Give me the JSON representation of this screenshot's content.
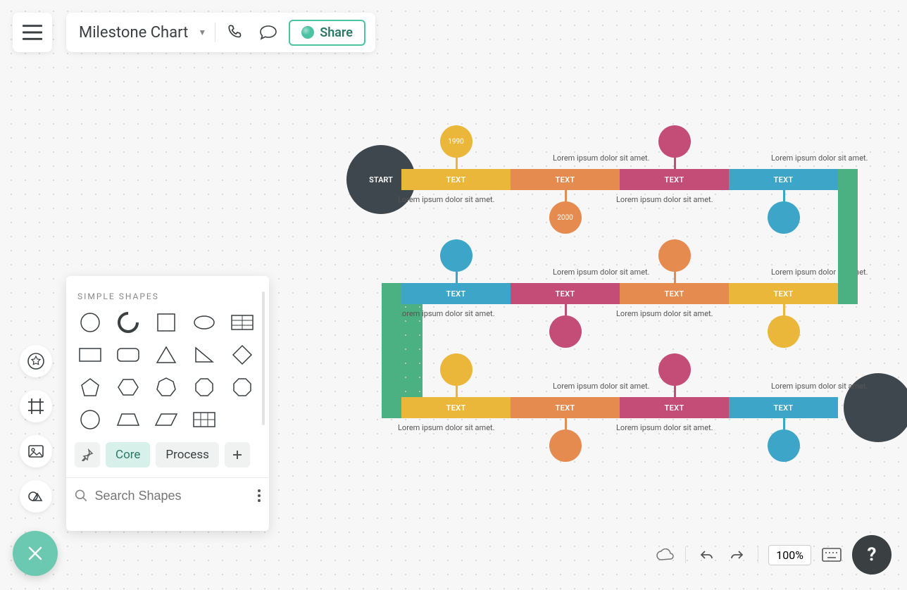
{
  "header": {
    "title": "Milestone Chart",
    "share_label": "Share"
  },
  "shapes_panel": {
    "title": "SIMPLE SHAPES",
    "tabs": {
      "core": "Core",
      "process": "Process"
    },
    "search_placeholder": "Search Shapes"
  },
  "footer": {
    "zoom": "100%",
    "help": "?"
  },
  "chart_data": {
    "type": "timeline-milestone",
    "start_label": "START",
    "lorem": "Lorem ipsum dolor sit amet.",
    "colors": {
      "yellow": "#ebb73b",
      "orange": "#e58b50",
      "pink": "#c34d77",
      "magenta": "#c34d77",
      "blue": "#3da6c8",
      "green": "#4bb183",
      "dark": "#3f474e"
    },
    "rows": [
      {
        "segments": [
          {
            "label": "TEXT",
            "color": "yellow",
            "bubble_pos": "above",
            "bubble_color": "yellow",
            "bubble_label": "1990",
            "annot_pos": "below"
          },
          {
            "label": "TEXT",
            "color": "orange",
            "bubble_pos": "below",
            "bubble_color": "orange",
            "bubble_label": "2000",
            "annot_pos": "above"
          },
          {
            "label": "TEXT",
            "color": "pink",
            "bubble_pos": "above",
            "bubble_color": "pink",
            "bubble_label": "",
            "annot_pos": "below"
          },
          {
            "label": "TEXT",
            "color": "blue",
            "bubble_pos": "below",
            "bubble_color": "blue",
            "bubble_label": "",
            "annot_pos": "above"
          }
        ]
      },
      {
        "segments": [
          {
            "label": "TEXT",
            "color": "blue",
            "bubble_pos": "above",
            "bubble_color": "blue",
            "bubble_label": "",
            "annot_pos": "below"
          },
          {
            "label": "TEXT",
            "color": "pink",
            "bubble_pos": "below",
            "bubble_color": "pink",
            "bubble_label": "",
            "annot_pos": "above"
          },
          {
            "label": "TEXT",
            "color": "orange",
            "bubble_pos": "above",
            "bubble_color": "orange",
            "bubble_label": "",
            "annot_pos": "below"
          },
          {
            "label": "TEXT",
            "color": "yellow",
            "bubble_pos": "below",
            "bubble_color": "yellow",
            "bubble_label": "",
            "annot_pos": "above"
          }
        ]
      },
      {
        "segments": [
          {
            "label": "TEXT",
            "color": "yellow",
            "bubble_pos": "above",
            "bubble_color": "yellow",
            "bubble_label": "",
            "annot_pos": "below"
          },
          {
            "label": "TEXT",
            "color": "orange",
            "bubble_pos": "below",
            "bubble_color": "orange",
            "bubble_label": "",
            "annot_pos": "above"
          },
          {
            "label": "TEXT",
            "color": "pink",
            "bubble_pos": "above",
            "bubble_color": "pink",
            "bubble_label": "",
            "annot_pos": "below"
          },
          {
            "label": "TEXT",
            "color": "blue",
            "bubble_pos": "below",
            "bubble_color": "blue",
            "bubble_label": "",
            "annot_pos": "above"
          }
        ]
      }
    ]
  }
}
